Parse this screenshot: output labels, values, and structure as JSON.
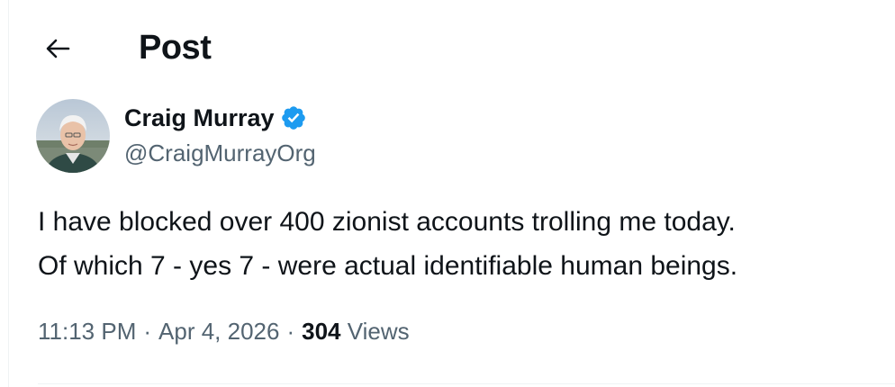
{
  "header": {
    "title": "Post",
    "back_icon": "arrow-left-icon"
  },
  "author": {
    "display_name": "Craig Murray",
    "handle": "@CraigMurrayOrg",
    "verified": true,
    "verified_icon": "verified-badge-icon",
    "verified_color": "#1d9bf0"
  },
  "tweet": {
    "lines": [
      "I have blocked over 400 zionist accounts trolling me today.",
      "Of which 7 - yes 7 - were actual identifiable human beings."
    ]
  },
  "meta": {
    "time": "11:13 PM",
    "separator": "·",
    "date": "Apr 4, 2026",
    "views_count": "304",
    "views_label": "Views"
  },
  "colors": {
    "text_primary": "#0f1419",
    "text_secondary": "#536471",
    "border": "#eff3f4",
    "accent": "#1d9bf0"
  }
}
